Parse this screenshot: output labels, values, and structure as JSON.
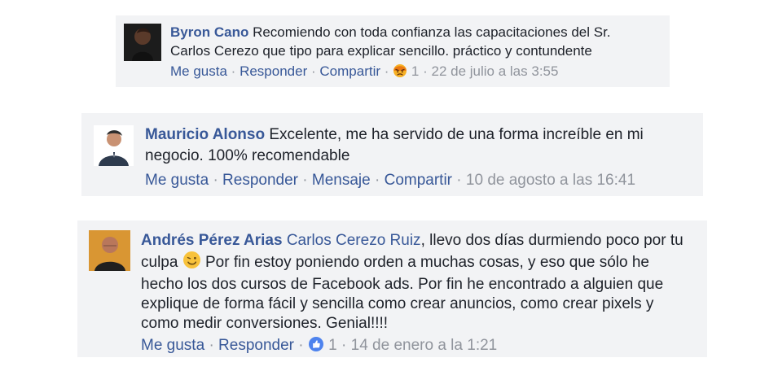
{
  "comments": [
    {
      "author": "Byron Cano",
      "text_lines": [
        "Recomiendo con toda confianza las capacitaciones del Sr.",
        "Carlos Cerezo que tipo para explicar sencillo. práctico y contundente"
      ],
      "actions": {
        "like": "Me gusta",
        "reply": "Responder",
        "share": "Compartir"
      },
      "separator": "·",
      "reaction_count": "1",
      "timestamp": "22 de julio a las 3:55",
      "reaction_icon": "angry-face-reaction-icon",
      "avatar_icon": "user-avatar-icon"
    },
    {
      "author": "Mauricio Alonso",
      "text_lines": [
        "Excelente, me ha servido de una forma increíble en mi",
        "negocio. 100% recomendable"
      ],
      "actions": {
        "like": "Me gusta",
        "reply": "Responder",
        "message": "Mensaje",
        "share": "Compartir"
      },
      "separator": "·",
      "timestamp": "10 de agosto a las 16:41",
      "avatar_icon": "user-avatar-icon"
    },
    {
      "author": "Andrés Pérez Arias",
      "mention": "Carlos Cerezo Ruiz",
      "text_lines": [
        ", llevo dos días durmiendo poco por tu",
        "culpa",
        " Por fin estoy poniendo orden a muchas cosas, y eso que sólo he",
        "hecho los dos cursos de Facebook ads. Por fin he encontrado a alguien que",
        "explique de forma fácil y sencilla como crear anuncios, como crear pixels y",
        "como medir conversiones. Genial!!!!"
      ],
      "actions": {
        "like": "Me gusta",
        "reply": "Responder"
      },
      "separator": "·",
      "reaction_count": "1",
      "timestamp": "14 de enero a la 1:21",
      "reaction_icon": "like-thumb-icon",
      "emoji_icon": "wink-emoji-icon",
      "avatar_icon": "user-avatar-icon"
    }
  ],
  "colors": {
    "card_background": "#f2f3f5",
    "link": "#385898",
    "text": "#1d2129",
    "muted": "#90949c"
  }
}
